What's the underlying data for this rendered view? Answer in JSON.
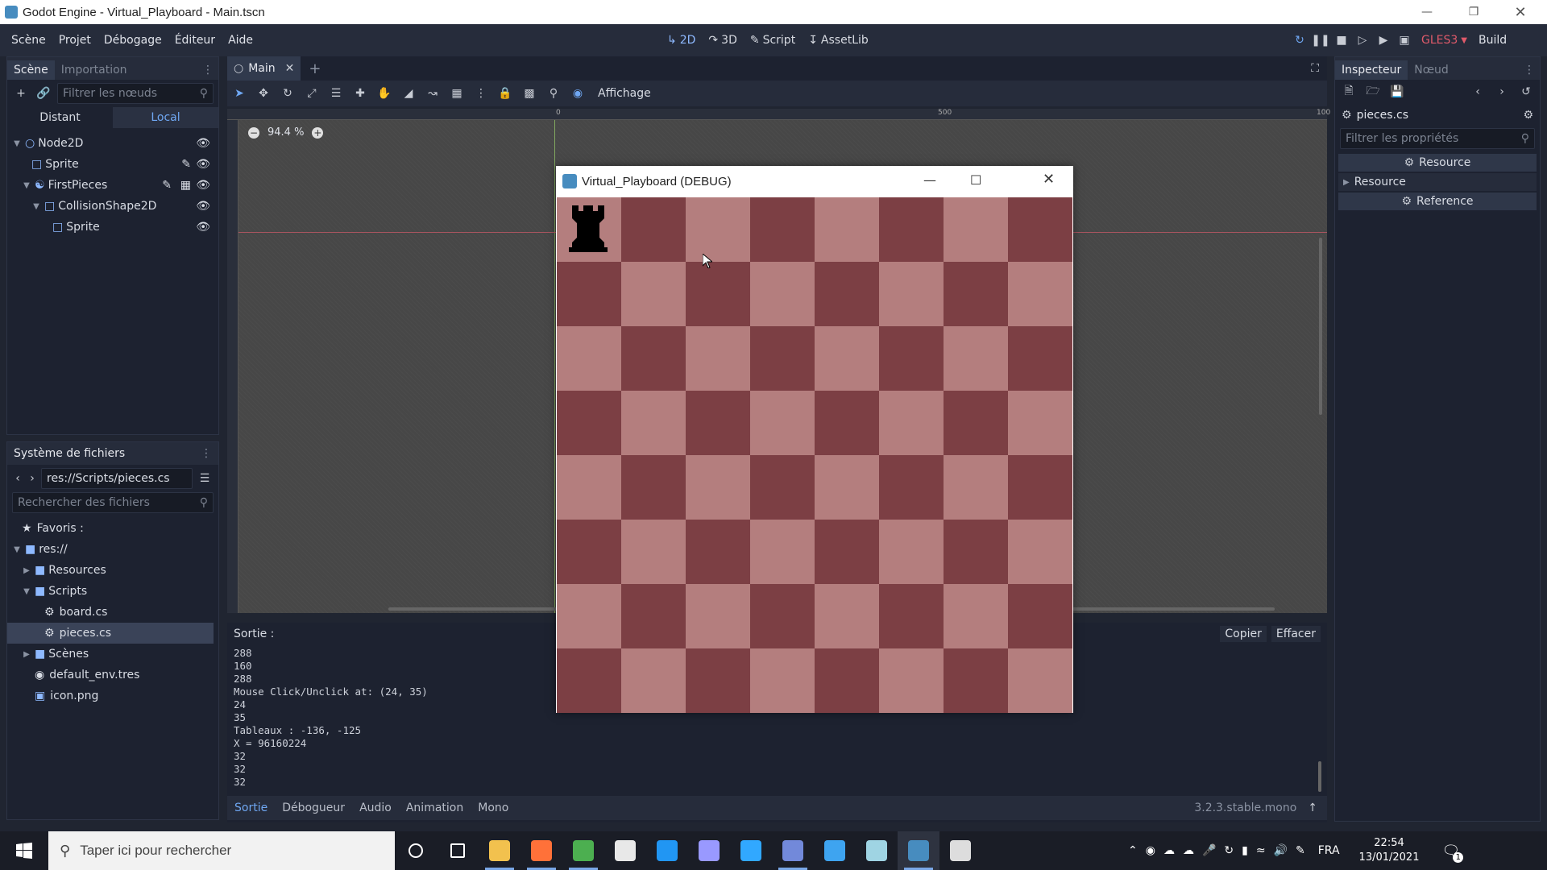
{
  "window": {
    "title": "Godot Engine - Virtual_Playboard - Main.tscn"
  },
  "menubar": {
    "items": [
      "Scène",
      "Projet",
      "Débogage",
      "Éditeur",
      "Aide"
    ],
    "modes": [
      {
        "label": "2D",
        "icon": "2d-icon",
        "active": true
      },
      {
        "label": "3D",
        "icon": "3d-icon",
        "active": false
      },
      {
        "label": "Script",
        "icon": "script-icon",
        "active": false
      },
      {
        "label": "AssetLib",
        "icon": "assetlib-icon",
        "active": false
      }
    ],
    "renderer": "GLES3",
    "build": "Build"
  },
  "scene_panel": {
    "tabs": [
      "Scène",
      "Importation"
    ],
    "filter_placeholder": "Filtrer les nœuds",
    "remote": "Distant",
    "local": "Local",
    "nodes": [
      {
        "name": "Node2D",
        "icon": "node2d-icon",
        "depth": 0,
        "expanded": true
      },
      {
        "name": "Sprite",
        "icon": "sprite-icon",
        "depth": 1
      },
      {
        "name": "FirstPieces",
        "icon": "kinematic-body-icon",
        "depth": 1,
        "expanded": true
      },
      {
        "name": "CollisionShape2D",
        "icon": "collision-shape-icon",
        "depth": 2,
        "expanded": true
      },
      {
        "name": "Sprite",
        "icon": "sprite-icon",
        "depth": 3
      }
    ]
  },
  "filesystem_panel": {
    "title": "Système de fichiers",
    "path": "res://Scripts/pieces.cs",
    "search_placeholder": "Rechercher des fichiers",
    "favorites": "Favoris :",
    "tree": [
      {
        "name": "res://",
        "icon": "folder-icon",
        "depth": 0,
        "expanded": true
      },
      {
        "name": "Resources",
        "icon": "folder-icon",
        "depth": 1,
        "expanded": false
      },
      {
        "name": "Scripts",
        "icon": "folder-icon",
        "depth": 1,
        "expanded": true
      },
      {
        "name": "board.cs",
        "icon": "csharp-icon",
        "depth": 2
      },
      {
        "name": "pieces.cs",
        "icon": "csharp-icon",
        "depth": 2,
        "selected": true
      },
      {
        "name": "Scènes",
        "icon": "folder-icon",
        "depth": 1,
        "expanded": false
      },
      {
        "name": "default_env.tres",
        "icon": "environment-icon",
        "depth": 1
      },
      {
        "name": "icon.png",
        "icon": "image-icon",
        "depth": 1
      }
    ]
  },
  "editor": {
    "tab": "Main",
    "view_menu": "Affichage",
    "zoom": "94.4 %",
    "ruler_marks": [
      "0",
      "500",
      "100"
    ]
  },
  "debug_window": {
    "title": "Virtual_Playboard (DEBUG)",
    "board_light": "#b47e7e",
    "board_dark": "#7c3f44",
    "piece": "black-rook-icon"
  },
  "output": {
    "label": "Sortie :",
    "copy": "Copier",
    "clear": "Effacer",
    "lines": [
      "288",
      "160",
      "288",
      "Mouse Click/Unclick at: (24, 35)",
      "24",
      "35",
      "Tableaux : -136, -125",
      "X = 96160224",
      "32",
      "32",
      "32"
    ],
    "bottom_tabs": [
      "Sortie",
      "Débogueur",
      "Audio",
      "Animation",
      "Mono"
    ],
    "version": "3.2.3.stable.mono"
  },
  "inspector": {
    "tabs": [
      "Inspecteur",
      "Nœud"
    ],
    "resource_name": "pieces.cs",
    "filter_placeholder": "Filtrer les propriétés",
    "sections": [
      "Resource",
      "Resource",
      "Reference"
    ]
  },
  "taskbar": {
    "search_placeholder": "Taper ici pour rechercher",
    "language": "FRA",
    "time": "22:54",
    "date": "13/01/2021",
    "notification_count": "1",
    "apps": [
      {
        "name": "cortana-icon",
        "color": "#ffffff"
      },
      {
        "name": "task-view-icon",
        "color": "#ffffff"
      },
      {
        "name": "file-explorer-icon",
        "color": "#f2c14e"
      },
      {
        "name": "firefox-icon",
        "color": "#ff7139"
      },
      {
        "name": "chrome-icon",
        "color": "#4caf50"
      },
      {
        "name": "store-icon",
        "color": "#e8e8e8"
      },
      {
        "name": "notepad-icon",
        "color": "#2196f3"
      },
      {
        "name": "premiere-icon",
        "color": "#9999ff"
      },
      {
        "name": "photoshop-icon",
        "color": "#31a8ff"
      },
      {
        "name": "discord-icon",
        "color": "#7289da"
      },
      {
        "name": "vscode-icon",
        "color": "#3ea4f0"
      },
      {
        "name": "app-icon",
        "color": "#9fd4e3"
      },
      {
        "name": "godot-icon",
        "color": "#478cbf"
      },
      {
        "name": "obs-icon",
        "color": "#dddddd"
      }
    ]
  }
}
